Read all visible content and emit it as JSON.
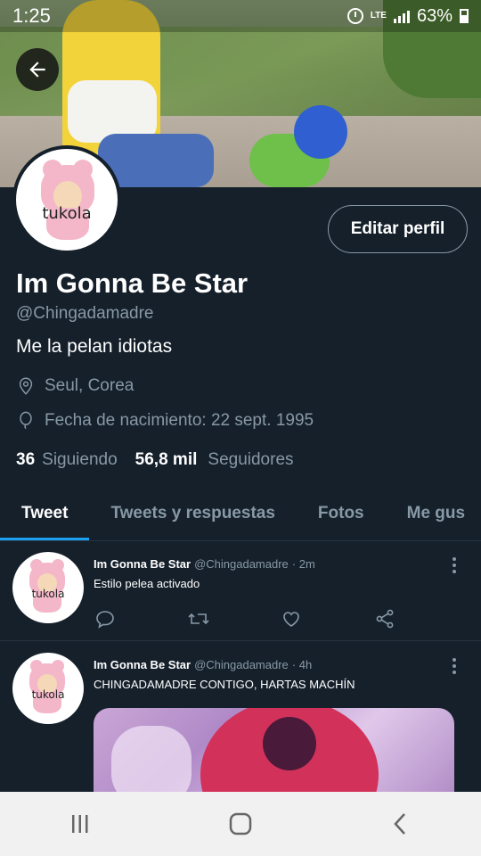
{
  "status_bar": {
    "time": "1:25",
    "network": "LTE",
    "battery": "63%"
  },
  "profile": {
    "avatar_text": "tukola",
    "edit_button": "Editar perfil",
    "name": "Im Gonna Be Star",
    "handle": "@Chingadamadre",
    "bio": "Me la pelan idiotas",
    "location": "Seul, Corea",
    "birthday": "Fecha de nacimiento: 22 sept. 1995",
    "following_count": "36",
    "following_label": "Siguiendo",
    "followers_count": "56,8 mil",
    "followers_label": "Seguidores"
  },
  "tabs": [
    {
      "label": "Tweet",
      "active": true
    },
    {
      "label": "Tweets y respuestas",
      "active": false
    },
    {
      "label": "Fotos",
      "active": false
    },
    {
      "label": "Me gus",
      "active": false
    }
  ],
  "tweets": [
    {
      "name": "Im Gonna Be Star",
      "handle": "@Chingadamadre",
      "time": "· 2m",
      "text": "Estilo pelea activado",
      "avatar_text": "tukola"
    },
    {
      "name": "Im Gonna Be Star",
      "handle": "@Chingadamadre",
      "time": "· 4h",
      "text": "CHINGADAMADRE CONTIGO, HARTAS MACHÍN",
      "avatar_text": "tukola"
    }
  ],
  "colors": {
    "background": "#15202b",
    "accent": "#1da1f2",
    "secondary_text": "#8899a6"
  },
  "icons": [
    "back-arrow-icon",
    "location-icon",
    "balloon-icon",
    "reply-icon",
    "retweet-icon",
    "like-icon",
    "share-icon",
    "more-icon",
    "recents-icon",
    "home-icon",
    "back-icon"
  ]
}
